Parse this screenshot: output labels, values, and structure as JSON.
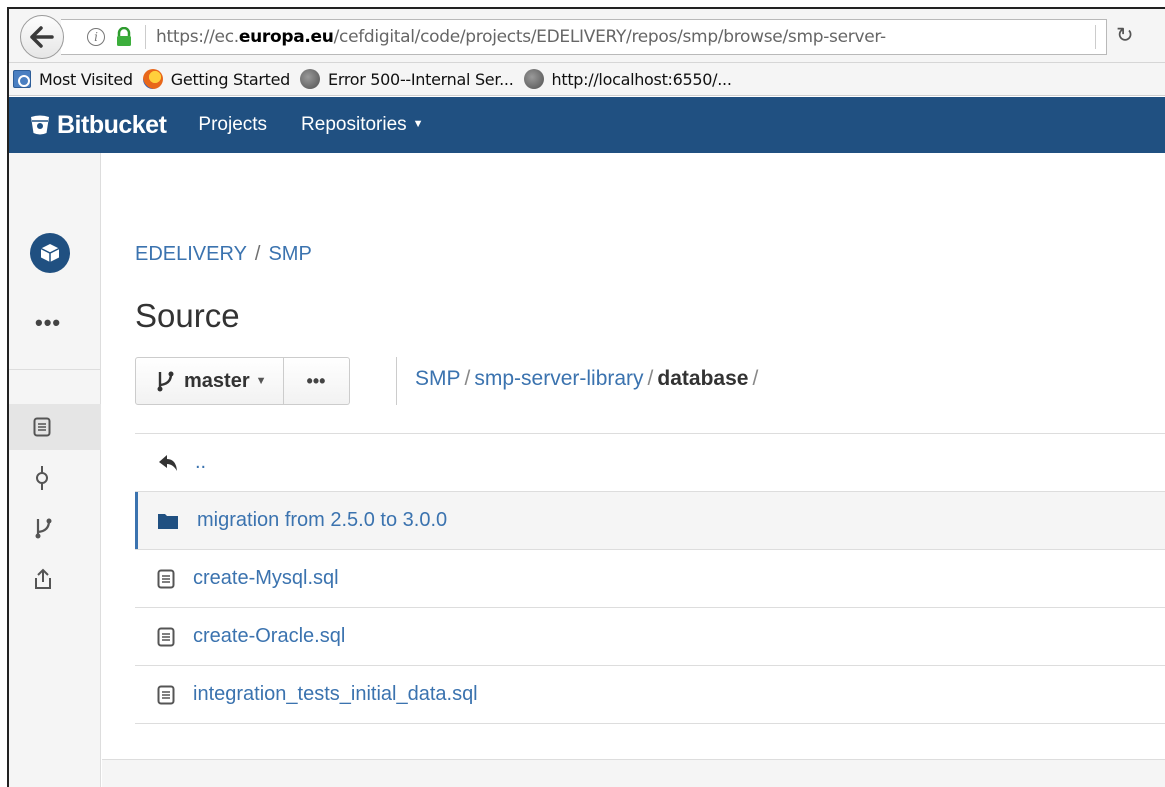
{
  "browser": {
    "url_prefix": "https://ec.",
    "url_domain": "europa.eu",
    "url_path": "/cefdigital/code/projects/EDELIVERY/repos/smp/browse/smp-server-",
    "bookmarks": [
      {
        "label": "Most Visited",
        "icon": "most-visited-icon"
      },
      {
        "label": "Getting Started",
        "icon": "firefox-icon"
      },
      {
        "label": "Error 500--Internal Ser...",
        "icon": "globe-icon"
      },
      {
        "label": "http://localhost:6550/...",
        "icon": "globe-icon"
      }
    ]
  },
  "header": {
    "logo": "Bitbucket",
    "nav": [
      "Projects",
      "Repositories"
    ]
  },
  "sidebar": {
    "more": "•••",
    "items": [
      {
        "icon": "source-icon",
        "active": true
      },
      {
        "icon": "commits-icon",
        "active": false
      },
      {
        "icon": "branches-icon",
        "active": false
      },
      {
        "icon": "share-icon",
        "active": false
      }
    ]
  },
  "main": {
    "breadcrumb": {
      "project": "EDELIVERY",
      "sep": "/",
      "repo": "SMP"
    },
    "title": "Source",
    "branch": "master",
    "more_label": "•••",
    "path": {
      "root": "SMP",
      "sep": "/",
      "folder": "smp-server-library",
      "current": "database"
    },
    "parent_label": "..",
    "files": [
      {
        "name": "migration from 2.5.0 to 3.0.0",
        "type": "folder"
      },
      {
        "name": "create-Mysql.sql",
        "type": "file"
      },
      {
        "name": "create-Oracle.sql",
        "type": "file"
      },
      {
        "name": "integration_tests_initial_data.sql",
        "type": "file"
      }
    ]
  },
  "colors": {
    "brand": "#205081",
    "link": "#3b73af"
  }
}
